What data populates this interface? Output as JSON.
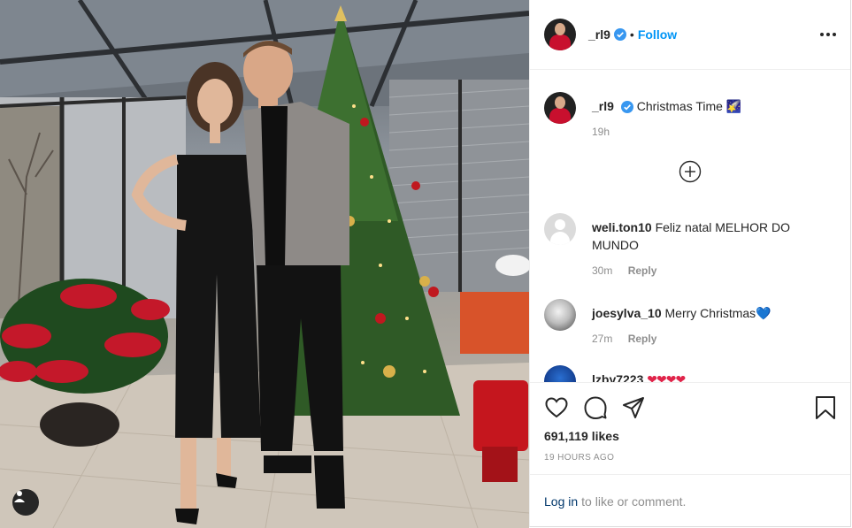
{
  "post": {
    "username": "_rl9",
    "follow_label": "Follow",
    "dot": "•"
  },
  "caption": {
    "username": "_rl9",
    "text": "Christmas Time 🌠",
    "time": "19h"
  },
  "comments": [
    {
      "username": "weli.ton10",
      "text": "Feliz natal MELHOR DO MUNDO",
      "time": "30m",
      "reply": "Reply"
    },
    {
      "username": "joesylva_10",
      "text": "Merry Christmas",
      "emoji": "💙",
      "time": "27m",
      "reply": "Reply"
    },
    {
      "username": "lzby7223",
      "text": "❤❤❤❤"
    }
  ],
  "stats": {
    "likes": "691,119 likes",
    "posted": "19 HOURS AGO"
  },
  "login": {
    "link": "Log in",
    "rest": "to like or comment."
  },
  "icons": [
    "user-tag-icon",
    "verified-icon",
    "more-options-icon",
    "load-more-icon",
    "heart-icon",
    "comment-icon",
    "share-icon",
    "bookmark-icon"
  ],
  "colors": {
    "accent": "#0095f6",
    "text": "#262626",
    "muted": "#8e8e8e",
    "link": "#00376b"
  }
}
